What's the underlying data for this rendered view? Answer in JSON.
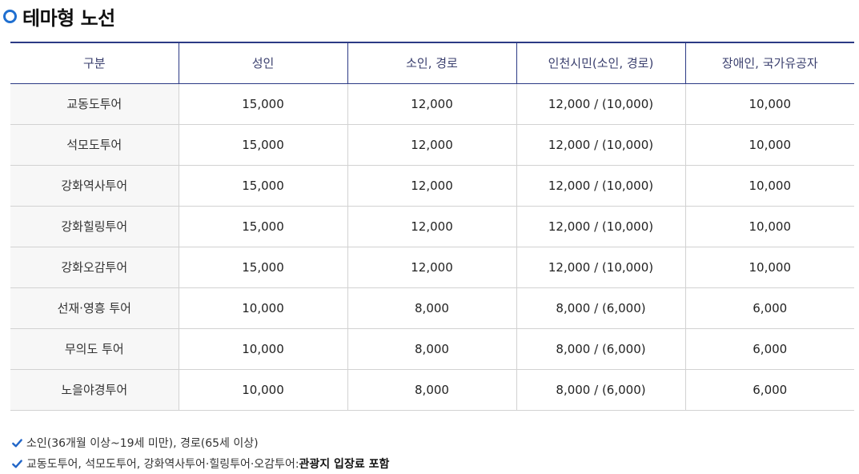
{
  "section": {
    "title": "테마형 노선",
    "accent_color": "#1f6fd0",
    "icon": "circle-bullet-icon"
  },
  "table": {
    "headers": [
      "구분",
      "성인",
      "소인, 경로",
      "인천시민(소인, 경로)",
      "장애인, 국가유공자"
    ],
    "rows": [
      [
        "교동도투어",
        "15,000",
        "12,000",
        "12,000 / (10,000)",
        "10,000"
      ],
      [
        "석모도투어",
        "15,000",
        "12,000",
        "12,000 / (10,000)",
        "10,000"
      ],
      [
        "강화역사투어",
        "15,000",
        "12,000",
        "12,000 / (10,000)",
        "10,000"
      ],
      [
        "강화힐링투어",
        "15,000",
        "12,000",
        "12,000 / (10,000)",
        "10,000"
      ],
      [
        "강화오감투어",
        "15,000",
        "12,000",
        "12,000 / (10,000)",
        "10,000"
      ],
      [
        "선재·영흥 투어",
        "10,000",
        "8,000",
        "8,000 / (6,000)",
        "6,000"
      ],
      [
        "무의도 투어",
        "10,000",
        "8,000",
        "8,000 / (6,000)",
        "6,000"
      ],
      [
        "노을야경투어",
        "10,000",
        "8,000",
        "8,000 / (6,000)",
        "6,000"
      ]
    ],
    "header_line_color": "#2c3a85"
  },
  "notes": {
    "icon": "check-icon",
    "check_color": "#2166c8",
    "note1": "소인(36개월 이상~19세 미만), 경로(65세 이상)",
    "note2_prefix": "교동도투어, 석모도투어, 강화역사투어·힐링투어·오감투어: ",
    "note2_bold": "관광지 입장료 포함"
  }
}
